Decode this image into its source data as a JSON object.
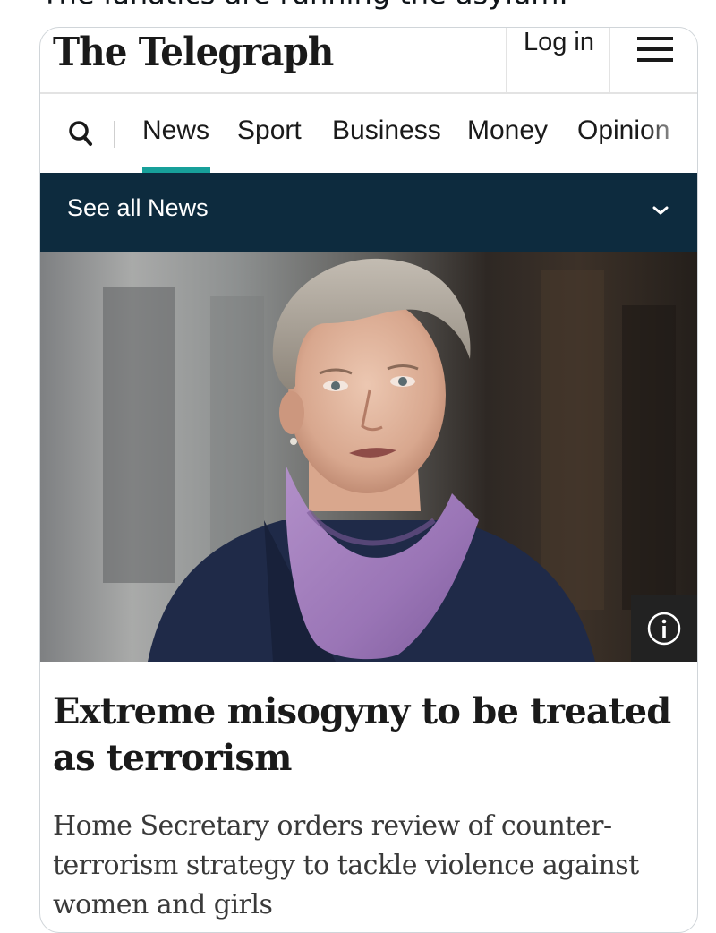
{
  "tweet": {
    "text": "The lunatics are running the asylum."
  },
  "masthead": {
    "logo": "The Telegraph",
    "login_label": "Log in",
    "menu_icon": "hamburger-menu-icon"
  },
  "nav": {
    "search_icon": "search-icon",
    "items": [
      "News",
      "Sport",
      "Business",
      "Money",
      "Opinion"
    ],
    "active": "News",
    "accent": "#17a09a"
  },
  "section": {
    "label": "See all News",
    "chevron_icon": "chevron-down-icon",
    "background": "#0d2b3e"
  },
  "article": {
    "image_alt": "Woman with short grey hair wearing a purple scarf and navy coat",
    "info_icon": "info-icon",
    "headline": "Extreme misogyny to be treated as terrorism",
    "standfirst": "Home Secretary orders review of counter-terrorism strategy to tackle violence against women and girls"
  }
}
